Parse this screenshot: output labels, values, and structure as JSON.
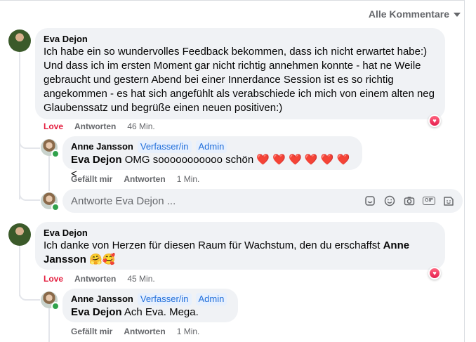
{
  "sort_label": "Alle Kommentare",
  "comments": [
    {
      "author": "Eva Dejon",
      "text": "Ich habe ein so wundervolles Feedback bekommen, dass ich nicht erwartet habe:) Und dass ich im ersten Moment gar nicht richtig annehmen konnte - hat ne Weile gebraucht und gestern Abend bei einer Innerdance Session ist es so richtig angekommen - es hat sich angefühlt als verabschiede ich mich von einem alten neg Glaubenssatz und begrüße einen neuen positiven:)",
      "reaction_label": "Love",
      "reply_label": "Antworten",
      "time": "46 Min.",
      "reaction_icon": "heart-reaction-icon",
      "reply": {
        "author": "Anne Jansson",
        "badge_author": "Verfasser/in",
        "badge_admin": "Admin",
        "mention": "Eva Dejon",
        "text": "OMG sooooooooooo schön ❤️ ❤️ ❤️ ❤️ ❤️ ❤️ <",
        "like_label": "Gefällt mir",
        "reply_label": "Antworten",
        "time": "1 Min."
      }
    },
    {
      "author": "Eva Dejon",
      "text_prefix": "Ich danke von Herzen für diesen Raum für Wachstum, den du erschaffst ",
      "mention": "Anne Jansson",
      "text_suffix": " 🤗🥰",
      "reaction_label": "Love",
      "reply_label": "Antworten",
      "time": "45 Min.",
      "reaction_icon": "heart-reaction-icon",
      "reply": {
        "author": "Anne Jansson",
        "badge_author": "Verfasser/in",
        "badge_admin": "Admin",
        "mention": "Eva Dejon",
        "text": "Ach Eva. Mega.",
        "like_label": "Gefällt mir",
        "reply_label": "Antworten",
        "time": "1 Min."
      }
    }
  ],
  "reply_box": {
    "placeholder": "Antworte Eva Dejon ...",
    "icons": [
      "sticker-icon",
      "emoji-icon",
      "camera-icon",
      "gif-icon",
      "avatar-sticker-icon"
    ]
  }
}
